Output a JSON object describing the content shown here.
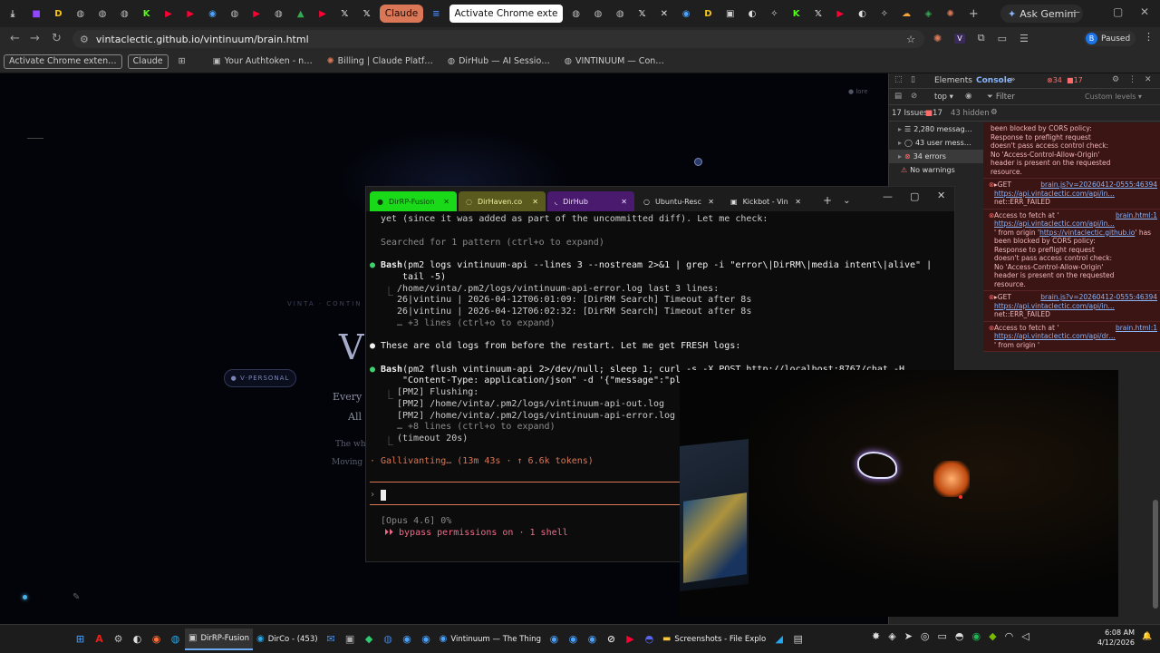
{
  "browser": {
    "tabs": [
      {
        "kind": "icon",
        "icon": "download-icon",
        "color": "#cfcfcf"
      },
      {
        "kind": "icon",
        "icon": "twitch-icon",
        "color": "#9146ff"
      },
      {
        "kind": "icon",
        "icon": "d-app-icon",
        "color": "#f5c518"
      },
      {
        "kind": "icon",
        "icon": "globe-icon",
        "color": "#bdbdbd"
      },
      {
        "kind": "icon",
        "icon": "globe-icon",
        "color": "#bdbdbd"
      },
      {
        "kind": "icon",
        "icon": "globe-icon",
        "color": "#bdbdbd"
      },
      {
        "kind": "icon",
        "icon": "kickbot-icon",
        "color": "#53fc18"
      },
      {
        "kind": "icon",
        "icon": "youtube-icon",
        "color": "#ff0033"
      },
      {
        "kind": "icon",
        "icon": "youtube-icon",
        "color": "#ff0033"
      },
      {
        "kind": "icon",
        "icon": "chrome-icon",
        "color": "#4aa3ff"
      },
      {
        "kind": "icon",
        "icon": "globe-icon",
        "color": "#bdbdbd"
      },
      {
        "kind": "icon",
        "icon": "youtube-icon",
        "color": "#ff0033"
      },
      {
        "kind": "icon",
        "icon": "globe-icon",
        "color": "#bdbdbd"
      },
      {
        "kind": "icon",
        "icon": "drive-icon",
        "color": "#34a853"
      },
      {
        "kind": "icon",
        "icon": "youtube-icon",
        "color": "#ff0033"
      },
      {
        "kind": "icon",
        "icon": "x-icon",
        "color": "#e0e0e0"
      },
      {
        "kind": "icon",
        "icon": "x-icon",
        "color": "#e0e0e0"
      },
      {
        "kind": "text",
        "label": "Claude",
        "bg": "#d97757",
        "fg": "#1a0a03"
      },
      {
        "kind": "icon",
        "icon": "docs-icon",
        "color": "#4285f4"
      },
      {
        "kind": "text",
        "label": "Activate Chrome exte",
        "bg": "#ffffff",
        "fg": "#111111",
        "active": true
      },
      {
        "kind": "icon",
        "icon": "globe-icon",
        "color": "#bdbdbd"
      },
      {
        "kind": "icon",
        "icon": "globe-icon",
        "color": "#bdbdbd"
      },
      {
        "kind": "icon",
        "icon": "globe-icon",
        "color": "#bdbdbd"
      },
      {
        "kind": "icon",
        "icon": "x-icon",
        "color": "#e0e0e0"
      },
      {
        "kind": "icon",
        "icon": "close-icon",
        "color": "#e0e0e0"
      },
      {
        "kind": "icon",
        "icon": "chrome-icon",
        "color": "#4aa3ff"
      },
      {
        "kind": "icon",
        "icon": "d-app-icon",
        "color": "#f5c518"
      },
      {
        "kind": "icon",
        "icon": "terminal-icon",
        "color": "#cfcfcf"
      },
      {
        "kind": "icon",
        "icon": "github-icon",
        "color": "#e0e0e0"
      },
      {
        "kind": "icon",
        "icon": "openai-icon",
        "color": "#cfcfcf"
      },
      {
        "kind": "icon",
        "icon": "kickbot-icon",
        "color": "#53fc18"
      },
      {
        "kind": "icon",
        "icon": "x-icon",
        "color": "#e0e0e0"
      },
      {
        "kind": "icon",
        "icon": "youtube-icon",
        "color": "#ff0033"
      },
      {
        "kind": "icon",
        "icon": "github-icon",
        "color": "#e0e0e0"
      },
      {
        "kind": "icon",
        "icon": "openai-icon",
        "color": "#cfcfcf"
      },
      {
        "kind": "icon",
        "icon": "cloud-icon",
        "color": "#f6a23a"
      },
      {
        "kind": "icon",
        "icon": "shield-icon",
        "color": "#34a853"
      },
      {
        "kind": "icon",
        "icon": "sparkle-icon",
        "color": "#d97757"
      }
    ],
    "new_tab": "+",
    "gemini": "Ask Gemini",
    "url": "vintaclectic.github.io/vintinuum/brain.html",
    "profile_initial": "B",
    "profile_status": "Paused",
    "bookmarks": [
      {
        "label": "Activate Chrome exten…",
        "boxed": true,
        "icon": ""
      },
      {
        "label": "Claude",
        "boxed": true,
        "icon": ""
      },
      {
        "label": "",
        "boxed": false,
        "icon": "apps-grid-icon"
      },
      {
        "label": "Your Authtoken - n…",
        "boxed": false,
        "icon": "n-icon"
      },
      {
        "label": "Billing | Claude Platf…",
        "boxed": false,
        "icon": "claude-icon"
      },
      {
        "label": "DirHub — AI Sessio…",
        "boxed": false,
        "icon": "globe-icon"
      },
      {
        "label": "VINTINUUM — Con…",
        "boxed": false,
        "icon": "globe-icon"
      }
    ]
  },
  "page": {
    "corner_tag": "● lore",
    "subtitle": "VINTA · CONTIN",
    "big_letter": "V",
    "personal_btn": "● V·PERSONAL",
    "line1": "Every b",
    "line2": "All d",
    "line3": "The wh",
    "line4": "Moving t"
  },
  "devtools": {
    "tabs": [
      "Elements",
      "Console"
    ],
    "active_tab": "Console",
    "error_count": "34",
    "warn_count": "17",
    "context": "top",
    "filter_placeholder": "Filter",
    "levels": "Custom levels",
    "issues_label": "17 Issues:",
    "issues_count": "17",
    "hidden": "43 hidden",
    "sidebar": [
      {
        "label": "2,280 messag…",
        "icon": "list-icon",
        "color": "#ddd"
      },
      {
        "label": "43 user mess…",
        "icon": "user-icon",
        "color": "#ddd"
      },
      {
        "label": "34 errors",
        "icon": "error-icon",
        "color": "#ddd"
      },
      {
        "label": "No warnings",
        "icon": "warning-icon",
        "color": "#ddd"
      }
    ],
    "messages": [
      {
        "type": "text",
        "text": "been blocked by CORS policy:\nResponse to preflight request\ndoesn't pass access control check:\nNo 'Access-Control-Allow-Origin'\nheader is present on the requested\nresource."
      },
      {
        "type": "get",
        "text": "▸GET",
        "link": "brain.js?v=20260412-0555:46394",
        "url": "https://api.vintaclectic.com/api/in…",
        "err": "net::ERR_FAILED"
      },
      {
        "type": "fetch",
        "text": "Access to fetch at '",
        "link": "brain.html:1",
        "url": "https://api.vintaclectic.com/api/in…",
        "tail": "' from origin '",
        "origin": "https://vintaclectic.github.io",
        "rest": "' has\nbeen blocked by CORS policy:\nResponse to preflight request\ndoesn't pass access control check:\nNo 'Access-Control-Allow-Origin'\nheader is present on the requested\nresource."
      },
      {
        "type": "get",
        "text": "▸GET",
        "link": "brain.js?v=20260412-0555:46394",
        "url": "https://api.vintaclectic.com/api/in…",
        "err": "net::ERR_FAILED"
      },
      {
        "type": "fetch2",
        "text": "Access to fetch at '",
        "link": "brain.html:1",
        "url": "https://api.vintaclectic.com/api/dr…",
        "tail": "' from origin '"
      }
    ]
  },
  "terminal": {
    "tabs": [
      {
        "label": "DirRP-Fusion",
        "bg": "#19d919",
        "fg": "#0a3a0a",
        "icon": "●"
      },
      {
        "label": "DirHaven.co",
        "bg": "#5a5a1e",
        "fg": "#f0f0a0",
        "icon": "◌"
      },
      {
        "label": "DirHub",
        "bg": "#4a1a6e",
        "fg": "#f0e0ff",
        "icon": "◟"
      },
      {
        "label": "Ubuntu-Resc",
        "bg": "#1c1c1c",
        "fg": "#dddddd",
        "icon": "○"
      },
      {
        "label": "Kickbot - Vin",
        "bg": "#1c1c1c",
        "fg": "#dddddd",
        "icon": "▣"
      }
    ],
    "plus": "+",
    "dropdown": "⌄",
    "lines": {
      "l1": "yet (since it was added as part of the uncommitted diff). Let me check:",
      "l2": "Searched for 1 pattern (ctrl+o to expand)",
      "l3_tool": "Bash",
      "l3": "(pm2 logs vintinuum-api --lines 3 --nostream 2>&1 | grep -i \"error\\|DirRM\\|media intent\\|alive\" |",
      "l4": "tail -5)",
      "l5": "/home/vinta/.pm2/logs/vintinuum-api-error.log last 3 lines:",
      "l6": "26|vintinu | 2026-04-12T06:01:09: [DirRM Search] Timeout after 8s",
      "l7": "26|vintinu | 2026-04-12T06:02:32: [DirRM Search] Timeout after 8s",
      "l8": "… +3 lines (ctrl+o to expand)",
      "l9": "These are old logs from before the restart. Let me get FRESH logs:",
      "l10_tool": "Bash",
      "l10": "(pm2 flush vintinuum-api 2>/dev/null; sleep 1; curl -s -X POST http://localhost:8767/chat -H",
      "l11": "\"Content-Type: application/json\" -d '{\"message\":\"pl",
      "l12": "[PM2] Flushing:",
      "l13": "[PM2] /home/vinta/.pm2/logs/vintinuum-api-out.log",
      "l14": "[PM2] /home/vinta/.pm2/logs/vintinuum-api-error.log",
      "l15": "… +8 lines (ctrl+o to expand)",
      "l16": "(timeout 20s)",
      "l17": "Gallivanting… (13m 43s · ↑ 6.6k tokens)",
      "prompt": "›",
      "status": "[Opus 4.6] 0%",
      "mode": "⏵⏵ bypass permissions on · 1 shell"
    }
  },
  "taskbar": {
    "items": [
      {
        "kind": "icon",
        "icon": "windows-start-icon",
        "color": "#3a8ee6"
      },
      {
        "kind": "icon",
        "icon": "acrobat-icon",
        "color": "#e2231a"
      },
      {
        "kind": "icon",
        "icon": "settings-icon",
        "color": "#bbbbbb"
      },
      {
        "kind": "icon",
        "icon": "ai-icon",
        "color": "#dddddd"
      },
      {
        "kind": "icon",
        "icon": "firefox-icon",
        "color": "#ff7139"
      },
      {
        "kind": "icon",
        "icon": "edge-icon",
        "color": "#2ba6e8"
      },
      {
        "kind": "text",
        "icon": "terminal-icon",
        "color": "#cccccc",
        "label": "DirRP-Fusion",
        "active": true
      },
      {
        "kind": "text",
        "icon": "dirco-icon",
        "color": "#2ba6e8",
        "label": "DirCo - (453)"
      },
      {
        "kind": "icon",
        "icon": "mail-icon",
        "color": "#4a8fe8"
      },
      {
        "kind": "icon",
        "icon": "terminal-icon",
        "color": "#aaaaaa"
      },
      {
        "kind": "icon",
        "icon": "dev-icon",
        "color": "#2ecc71"
      },
      {
        "kind": "icon",
        "icon": "edge-icon",
        "color": "#3b7de0"
      },
      {
        "kind": "icon",
        "icon": "chrome-icon",
        "color": "#4aa3ff"
      },
      {
        "kind": "icon",
        "icon": "chrome-icon",
        "color": "#4aa3ff"
      },
      {
        "kind": "text",
        "icon": "chrome-icon",
        "color": "#4aa3ff",
        "label": "Vintinuum — The Thing"
      },
      {
        "kind": "icon",
        "icon": "chrome-icon",
        "color": "#4aa3ff"
      },
      {
        "kind": "icon",
        "icon": "chrome-icon",
        "color": "#4aa3ff"
      },
      {
        "kind": "icon",
        "icon": "chrome-icon",
        "color": "#4aa3ff"
      },
      {
        "kind": "icon",
        "icon": "blocked-icon",
        "color": "#dddddd"
      },
      {
        "kind": "icon",
        "icon": "youtube-icon",
        "color": "#ff0033"
      },
      {
        "kind": "icon",
        "icon": "discord-icon",
        "color": "#5865f2"
      },
      {
        "kind": "text",
        "icon": "folder-icon",
        "color": "#f5c542",
        "label": "Screenshots - File Explo"
      },
      {
        "kind": "icon",
        "icon": "vscode-icon",
        "color": "#23a9f2"
      },
      {
        "kind": "icon",
        "icon": "notes-icon",
        "color": "#cccccc"
      }
    ],
    "tray": [
      {
        "icon": "gear-tray-icon",
        "color": "#ddd"
      },
      {
        "icon": "shield-tray-icon",
        "color": "#ddd"
      },
      {
        "icon": "telegram-icon",
        "color": "#ddd"
      },
      {
        "icon": "obs-icon",
        "color": "#ddd"
      },
      {
        "icon": "car-icon",
        "color": "#ddd"
      },
      {
        "icon": "discord-tray-icon",
        "color": "#ddd"
      },
      {
        "icon": "spotify-icon",
        "color": "#1db954"
      },
      {
        "icon": "nvidia-icon",
        "color": "#76b900"
      },
      {
        "icon": "wifi-icon",
        "color": "#ddd"
      },
      {
        "icon": "volume-icon",
        "color": "#ddd"
      }
    ],
    "time": "6:08 AM",
    "date": "4/12/2026"
  }
}
